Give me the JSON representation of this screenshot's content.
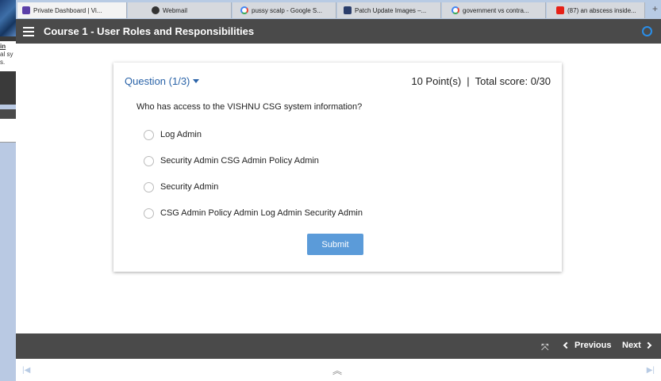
{
  "background": {
    "snippet_lines": [
      "in",
      "al sy",
      "s."
    ]
  },
  "browser": {
    "tabs": [
      {
        "label": "Private Dashboard | Vi...",
        "icon": "dashboard-favicon",
        "color": "#5b3fa8"
      },
      {
        "label": "Webmail",
        "icon": "webmail-favicon",
        "color": "#333333"
      },
      {
        "label": "pussy scalp - Google S...",
        "icon": "google-favicon",
        "color": "#4285f4"
      },
      {
        "label": "Patch Update Images –...",
        "icon": "patch-favicon",
        "color": "#2b3e6b"
      },
      {
        "label": "government vs contra...",
        "icon": "google-favicon",
        "color": "#4285f4"
      },
      {
        "label": "(87) an abscess inside...",
        "icon": "youtube-favicon",
        "color": "#e62117"
      }
    ],
    "new_tab_label": "+"
  },
  "header": {
    "title": "Course 1 - User Roles and Responsibilities",
    "menu_icon": "hamburger-menu-icon",
    "progress_icon": "progress-ring-icon"
  },
  "quiz": {
    "question_label": "Question (1/3)",
    "points": "10 Point(s)",
    "separator": "|",
    "total_score": "Total score: 0/30",
    "prompt": "Who has access to the VISHNU CSG system information?",
    "options": [
      "Log Admin",
      "Security Admin CSG Admin Policy Admin",
      "Security Admin",
      "CSG Admin Policy Admin Log Admin Security Admin"
    ],
    "submit_label": "Submit",
    "accent": "#2a63a8",
    "button_color": "#5b9bd9"
  },
  "nav": {
    "fullscreen_icon": "⤧",
    "previous_label": "Previous",
    "next_label": "Next"
  },
  "footer": {
    "skip_start": "|◀",
    "collapse": "︽",
    "skip_end": "▶|"
  }
}
